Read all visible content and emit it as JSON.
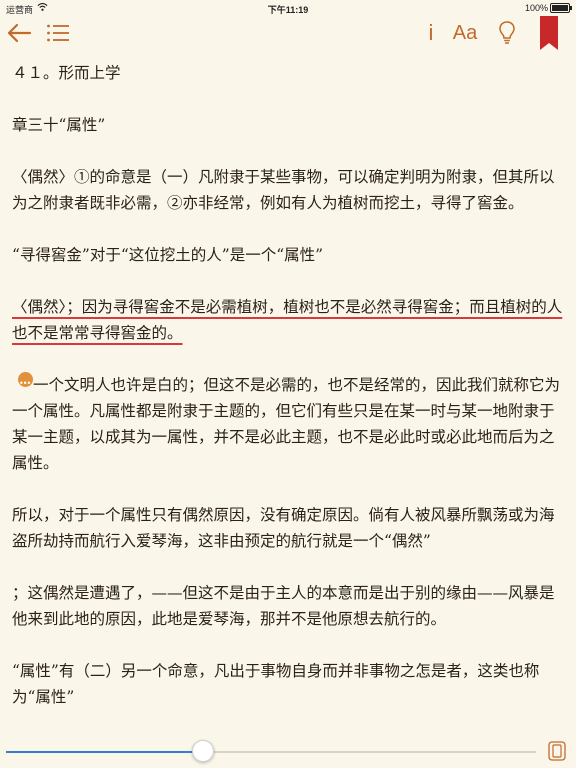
{
  "status": {
    "carrier": "运营商",
    "time": "下午11:19",
    "battery": "100%"
  },
  "toolbar": {
    "info_label": "i",
    "font_label": "Aa",
    "accent": "#c26a2c",
    "bookmark_color": "#c8282a"
  },
  "content": {
    "paragraphs": [
      {
        "text": "４１。形而上学"
      },
      {
        "gap": true
      },
      {
        "text": "章三十“属性”"
      },
      {
        "gap": true
      },
      {
        "text": "〈偶然〉①的命意是（一）凡附隶于某些事物，可以确定判明为附隶，但其所以为之附隶者既非必需，②亦非经常，例如有人为植树而挖土，寻得了窖金。"
      },
      {
        "gap": true
      },
      {
        "text": "“寻得窖金”对于“这位挖土的人”是一个“属性”"
      },
      {
        "gap": true
      },
      {
        "text": "〈偶然〉；因为寻得窖金不是必需植树，植树也不是必然寻得窖金；而且植树的人也不是常常寻得窖金的。",
        "highlight": true
      },
      {
        "gap": true
      },
      {
        "text": "一个文明人也许是白的；但这不是必需的，也不是经常的，因此我们就称它为一个属性。凡属性都是附隶于主题的，但它们有些只是在某一时与某一地附隶于某一主题，以成其为一属性，并不是必此主题，也不是必此时或必此地而后为之属性。",
        "note": true
      },
      {
        "gap": true
      },
      {
        "text": "所以，对于一个属性只有偶然原因，没有确定原因。倘有人被风暴所飘荡或为海盗所劫持而航行入爱琴海，这非由预定的航行就是一个“偶然”"
      },
      {
        "gap": true
      },
      {
        "text": "；这偶然是遭遇了，——但这不是由于主人的本意而是出于别的缘由——风暴是他来到此地的原因，此地是爱琴海，那并不是他原想去航行的。"
      },
      {
        "gap": true
      },
      {
        "text": "“属性”有（二）另一个命意，凡出于事物自身而并非事物之怎是者，这类也称为“属性”"
      }
    ]
  },
  "progress": {
    "fraction": 0.37,
    "color": "#3a7bd5"
  }
}
